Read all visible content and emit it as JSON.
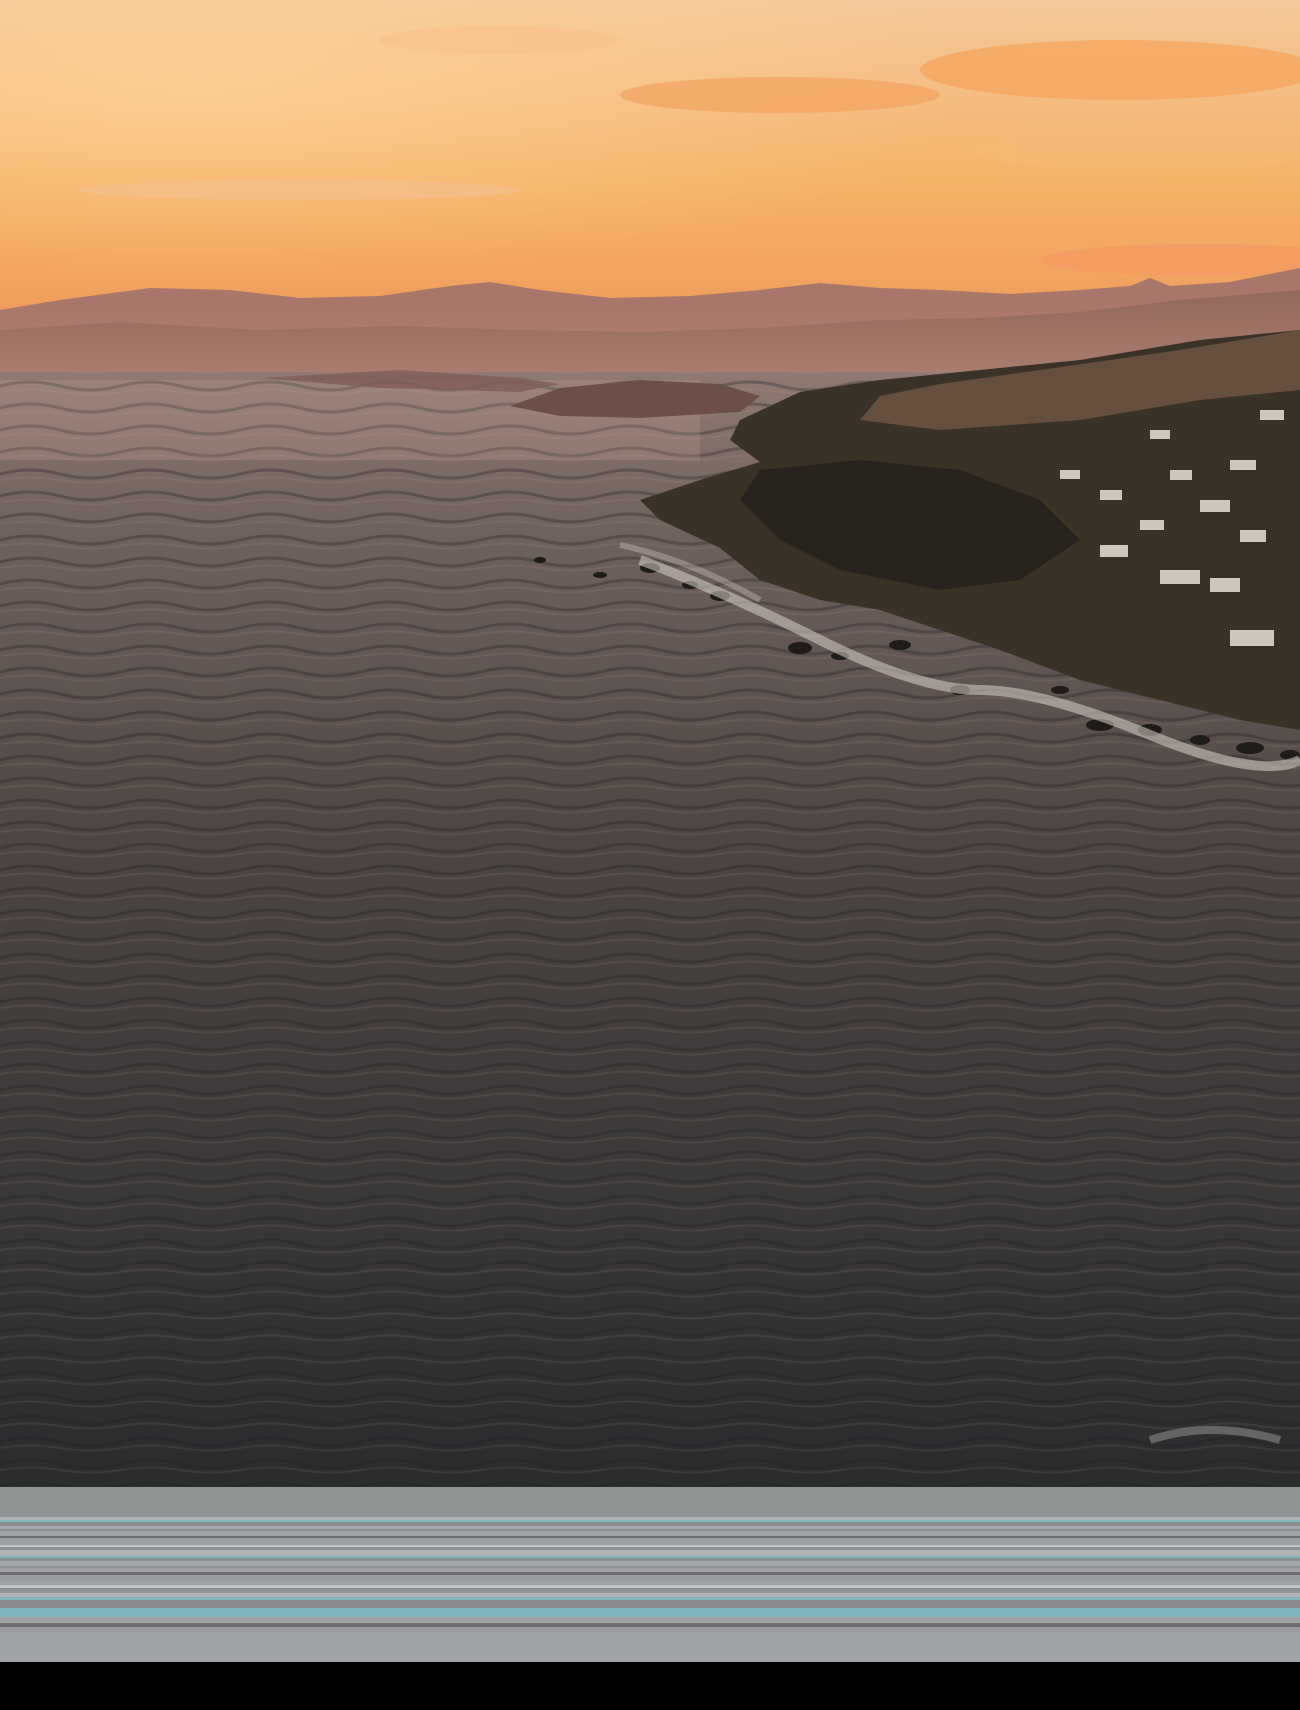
{
  "photo": {
    "subject": "coastal-sunset-aerial",
    "colors": {
      "sky_top": "#f6d3a0",
      "sky_mid": "#f5b870",
      "sky_horizon": "#f09a55",
      "cloud": "#f7c58c",
      "mountain_far": "#a97a6e",
      "mountain_near": "#8c6257",
      "haze": "#b98a7a",
      "sea_top": "#8a7670",
      "sea_mid": "#4e4644",
      "sea_bottom": "#2b2d2f",
      "land_dark": "#2f2b24",
      "land_mid": "#4a3f31",
      "foam": "#d8d2cc"
    }
  },
  "glitch": {
    "colors": [
      "#8f9293",
      "#a5a6aa",
      "#9a9ca0",
      "#b1b2b6",
      "#8c8f93",
      "#9fa2a6",
      "#7fb5bb",
      "#a0a2a5",
      "#c3c4c6",
      "#8a8c8f",
      "#6c6e70"
    ]
  }
}
